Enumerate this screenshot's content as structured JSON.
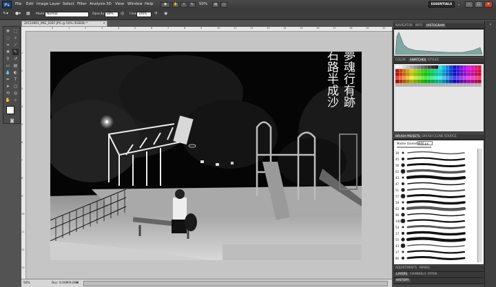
{
  "app": {
    "logo": "Ps"
  },
  "menu": [
    "File",
    "Edit",
    "Image",
    "Layer",
    "Select",
    "Filter",
    "Analysis",
    "3D",
    "View",
    "Window",
    "Help"
  ],
  "menubar": {
    "zoom": "50%",
    "workspace": "ESSENTIALS"
  },
  "options": {
    "mode_label": "Mode:",
    "mode_value": "Normal",
    "opacity_label": "Opacity:",
    "opacity_value": "80%",
    "flow_label": "Flow:",
    "flow_value": "100%"
  },
  "document": {
    "tab_title": "20110901_IMG_0287.JPG @ 50% (RGB/8) *",
    "zoom": "50%",
    "doc_info": "Doc: 9.00M/9.00M",
    "ruler_h": [
      "0",
      "1",
      "2",
      "3",
      "4",
      "5",
      "6",
      "7",
      "8",
      "9",
      "10",
      "11",
      "12",
      "13",
      "14",
      "15",
      "16",
      "17",
      "18",
      "19",
      "20"
    ],
    "ruler_v": [
      "1",
      "2",
      "3",
      "4",
      "5",
      "6",
      "7",
      "8",
      "9",
      "10",
      "11",
      "12",
      "13"
    ],
    "poem_columns": [
      "若使夢魂行有跡",
      "門前石路半成沙"
    ]
  },
  "panels": {
    "top_tabs": [
      "NAVIGATOR",
      "INFO",
      "HISTOGRAM"
    ],
    "color_tabs": [
      "COLOR",
      "SWATCHES",
      "STYLES"
    ],
    "brush_tabs": [
      "BRUSH PRESETS",
      "BRUSH",
      "CLONE SOURCE"
    ],
    "master_diameter_label": "Master Diameter",
    "brush_size": "666 px",
    "brush_sizes": [
      "39",
      "45",
      "56",
      "62",
      "43",
      "47",
      "51",
      "57",
      "59",
      "63",
      "90",
      "100",
      "54",
      "17",
      "55",
      "43",
      "17",
      "80"
    ],
    "adjustments_tabs": [
      "ADJUSTMENTS",
      "MASKS"
    ],
    "layers_tabs": [
      "LAYERS",
      "CHANNELS",
      "PATHS"
    ],
    "history_tab": "HISTORY"
  },
  "colors": {
    "ui_dark": "#535353",
    "panel": "#474747",
    "swatch_accent": "#ff0000"
  }
}
